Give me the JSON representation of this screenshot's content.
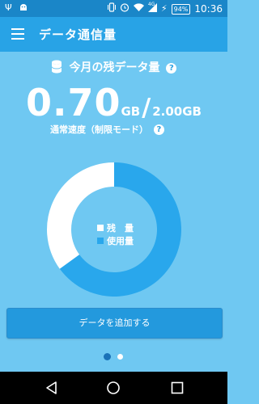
{
  "status_bar": {
    "left_icons": [
      "usb-icon",
      "android-debug-icon"
    ],
    "right_icons": [
      "vibrate-icon",
      "alarm-icon",
      "wifi-icon",
      "signal-4g-icon",
      "charging-icon"
    ],
    "network_label": "4G",
    "battery": "94%",
    "time": "10:36"
  },
  "app_bar": {
    "title": "データ通信量"
  },
  "usage": {
    "label": "今月の残データ量",
    "remaining_value": "0.70",
    "remaining_unit": "GB",
    "separator": "/",
    "total": "2.00GB",
    "speed_label": "通常速度（制限モード）"
  },
  "chart_data": {
    "type": "pie",
    "labels": [
      "残　量",
      "使用量"
    ],
    "values": [
      0.7,
      1.3
    ],
    "colors": [
      "#ffffff",
      "#29a7ec"
    ]
  },
  "legend": [
    {
      "label": "残　量",
      "color": "#ffffff"
    },
    {
      "label": "使用量",
      "color": "#29a7ec"
    }
  ],
  "actions": {
    "add_data_label": "データを追加する"
  },
  "pager": {
    "pages": 2,
    "current": 1
  }
}
